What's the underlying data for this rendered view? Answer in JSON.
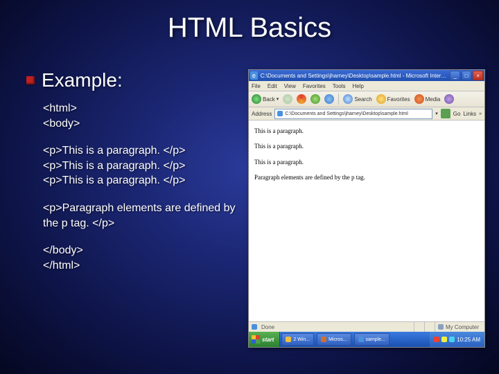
{
  "slide": {
    "title": "HTML Basics",
    "heading": "Example:",
    "code": {
      "l1": "<html>",
      "l2": "<body>",
      "l3": "<p>This is a paragraph. </p>",
      "l4": "<p>This is a paragraph. </p>",
      "l5": "<p>This is a paragraph. </p>",
      "l6": "<p>Paragraph elements are defined by the p tag. </p>",
      "l7": "</body>",
      "l8": "</html>"
    }
  },
  "browser": {
    "title": "C:\\Documents and Settings\\jharney\\Desktop\\sample.html - Microsoft Internet Explorer",
    "menu": {
      "file": "File",
      "edit": "Edit",
      "view": "View",
      "favorites": "Favorites",
      "tools": "Tools",
      "help": "Help"
    },
    "toolbar": {
      "back": "Back",
      "search": "Search",
      "favorites": "Favorites",
      "media": "Media"
    },
    "address_label": "Address",
    "address_value": "C:\\Documents and Settings\\jharney\\Desktop\\sample.html",
    "go": "Go",
    "links": "Links",
    "page": {
      "p1": "This is a paragraph.",
      "p2": "This is a paragraph.",
      "p3": "This is a paragraph.",
      "p4": "Paragraph elements are defined by the p tag."
    },
    "status": {
      "done": "Done",
      "zone": "My Computer"
    }
  },
  "taskbar": {
    "start": "start",
    "buttons": [
      "2 Win...",
      "Micros...",
      "sample..."
    ],
    "clock": "10:25 AM"
  }
}
